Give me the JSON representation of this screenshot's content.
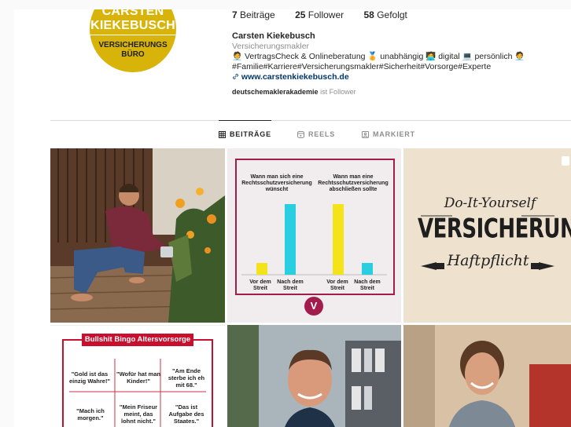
{
  "profile": {
    "logo": {
      "line1": "CARSTEN",
      "line2": "KIEKEBUSCH",
      "line3": "VERSICHERUNGS",
      "line4": "BÜRO"
    },
    "stats": [
      {
        "value": "7",
        "label": "Beiträge"
      },
      {
        "value": "25",
        "label": "Follower"
      },
      {
        "value": "58",
        "label": "Gefolgt"
      }
    ],
    "name": "Carsten Kiekebusch",
    "category": "Versicherungsmakler",
    "bio_line1": "🧑‍💼 VertragsCheck & Onlineberatung 🏅 unabhängig 🧑‍💻 digital 💻 persönlich 🧑‍💼",
    "bio_line2": "#Familie#Karriere#Versicherungsmakler#Sicherheit#Vorsorge#Experte",
    "link": "www.carstenkiekebusch.de",
    "followed_by_user": "deutschemaklerakademie",
    "followed_by_text": " ist Follower"
  },
  "tabs": [
    {
      "label": "BEITRÄGE",
      "icon": "grid-icon"
    },
    {
      "label": "REELS",
      "icon": "reels-icon"
    },
    {
      "label": "MARKIERT",
      "icon": "tagged-icon"
    }
  ],
  "posts": {
    "chart": {
      "header_left": "Wann man sich eine Rechtsschutzversicherung wünscht",
      "header_right": "Wann man eine Rechtsschutzversicherung abschließen sollte",
      "bar_labels": [
        "Vor dem Streit",
        "Nach dem Streit",
        "Vor dem Streit",
        "Nach dem Streit"
      ],
      "badge": "V"
    },
    "diy": {
      "title": "Do-It-Yourself",
      "main": "VERSICHERUNG",
      "sub": "Haftpflicht"
    },
    "bingo": {
      "title": "Bullshit Bingo Altersvorsorge",
      "cells": [
        "\"Gold ist das einzig Wahre!\"",
        "\"Wofür hat man Kinder!\"",
        "\"Am Ende sterbe ich eh mit 68.\"",
        "\"Mach ich morgen.\"",
        "\"Mein Friseur meint, das lohnt nicht.\"",
        "\"Das ist Aufgabe des Staates.\""
      ]
    }
  },
  "colors": {
    "accent": "#a31d4c",
    "bingo_red": "#c8102e",
    "logo_gold": "#d8b40a"
  }
}
